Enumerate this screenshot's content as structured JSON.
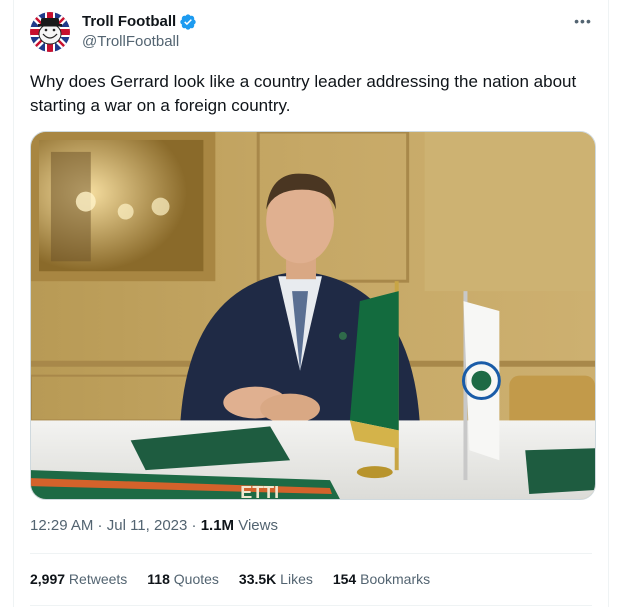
{
  "author": {
    "display_name": "Troll Football",
    "handle": "@TrollFootball",
    "avatar_icon": "troll-face-union-jack-icon",
    "verified_icon": "verified-badge-icon",
    "verified_color": "#1d9bf0"
  },
  "more_icon": "ellipsis-icon",
  "tweet": {
    "text": "Why does Gerrard look like a country leader addressing the nation about starting a war on a foreign country."
  },
  "media": {
    "type": "photo",
    "scarf_text": "ETTI"
  },
  "meta": {
    "time": "12:29 AM",
    "separator1": " · ",
    "date": "Jul 11, 2023",
    "separator2": " · ",
    "views_count": "1.1M",
    "views_label": " Views"
  },
  "stats": [
    {
      "count": "2,997",
      "label": " Retweets"
    },
    {
      "count": "118",
      "label": " Quotes"
    },
    {
      "count": "33.5K",
      "label": " Likes"
    },
    {
      "count": "154",
      "label": " Bookmarks"
    }
  ],
  "colors": {
    "text_primary": "#0f1419",
    "text_secondary": "#536471",
    "border": "#eff3f4",
    "accent": "#1d9bf0"
  }
}
